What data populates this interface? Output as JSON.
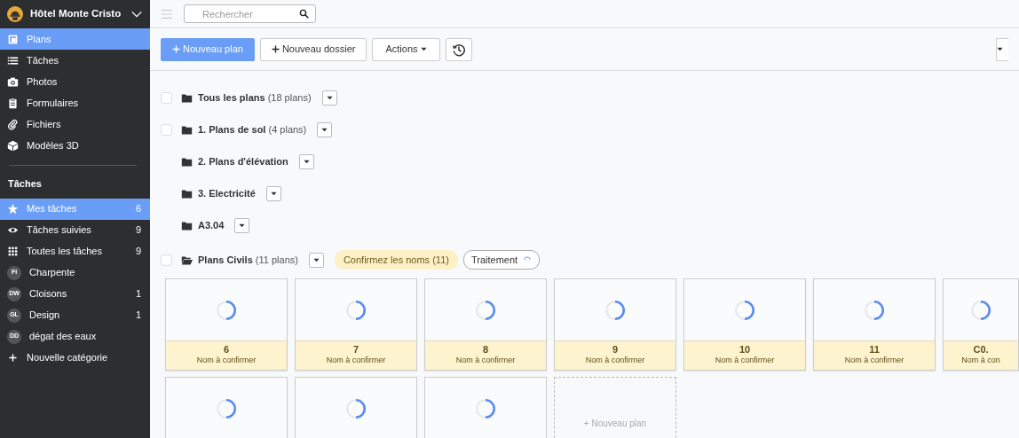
{
  "sidebar": {
    "project": {
      "title": "Hôtel Monte Cristo"
    },
    "items": [
      {
        "label": "Plans",
        "selected": true
      },
      {
        "label": "Tâches",
        "selected": false
      },
      {
        "label": "Photos",
        "selected": false
      },
      {
        "label": "Formulaires",
        "selected": false
      },
      {
        "label": "Fichiers",
        "selected": false
      },
      {
        "label": "Modèles 3D",
        "selected": false
      }
    ],
    "section_title": "Tâches",
    "task_items": [
      {
        "kind": "icon",
        "label": "Mes tâches",
        "count": "6",
        "selected": true
      },
      {
        "kind": "icon",
        "label": "Tâches suivies",
        "count": "9",
        "selected": false
      },
      {
        "kind": "icon",
        "label": "Toutes les tâches",
        "count": "9",
        "selected": false
      },
      {
        "kind": "initials",
        "initials": "FI",
        "label": "Charpente",
        "selected": false
      },
      {
        "kind": "initials",
        "initials": "DW",
        "label": "Cloisons",
        "count": "1",
        "selected": false
      },
      {
        "kind": "initials",
        "initials": "GL",
        "label": "Design",
        "count": "1",
        "selected": false
      },
      {
        "kind": "initials",
        "initials": "DD",
        "label": "dégat des eaux",
        "selected": false
      },
      {
        "kind": "add",
        "label": "Nouvelle catégorie",
        "selected": false
      }
    ]
  },
  "topbar": {
    "search": {
      "placeholder": "Rechercher"
    }
  },
  "toolbar": {
    "buttons": [
      {
        "kind": "primary",
        "label": "Nouveau plan"
      },
      {
        "kind": "secondary",
        "label": "Nouveau dossier"
      },
      {
        "kind": "dropdown",
        "label": "Actions"
      },
      {
        "kind": "history"
      }
    ]
  },
  "folders": [
    {
      "name": "Tous les plans",
      "count": "(18 plans)",
      "checkbox": {
        "checked": false
      },
      "expanded": false
    },
    {
      "name": "1. Plans de sol",
      "count": "(4 plans)",
      "checkbox": {
        "checked": false
      },
      "expanded": false
    },
    {
      "name": "2. Plans d'élévation",
      "expanded": false
    },
    {
      "name": "3. Electricité",
      "expanded": false
    },
    {
      "name": "A3.04",
      "expanded": false
    },
    {
      "name": "Plans Civils",
      "count": "(11 plans)",
      "checkbox": {
        "checked": false
      },
      "expanded": true,
      "badges": [
        {
          "kind": "warning",
          "label": "Confirmez les noms (11)"
        },
        {
          "kind": "processing",
          "label": "Traitement"
        }
      ]
    }
  ],
  "tiles": [
    {
      "kind": "plan",
      "title": "6",
      "subtitle": "Nom à confirmer"
    },
    {
      "kind": "plan",
      "title": "7",
      "subtitle": "Nom à confirmer"
    },
    {
      "kind": "plan",
      "title": "8",
      "subtitle": "Nom à confirmer"
    },
    {
      "kind": "plan",
      "title": "9",
      "subtitle": "Nom à confirmer"
    },
    {
      "kind": "plan",
      "title": "10",
      "subtitle": "Nom à confirmer"
    },
    {
      "kind": "plan",
      "title": "11",
      "subtitle": "Nom à confirmer"
    },
    {
      "kind": "plan",
      "title": "C0.",
      "subtitle": "Nom à con"
    },
    {
      "kind": "plan"
    },
    {
      "kind": "plan"
    },
    {
      "kind": "plan"
    },
    {
      "kind": "add",
      "label": "+ Nouveau plan"
    }
  ]
}
